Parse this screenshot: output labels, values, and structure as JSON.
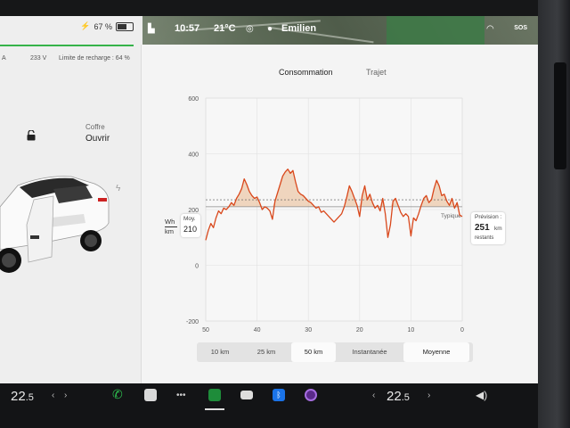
{
  "status": {
    "battery_percent": "67 %",
    "time": "10:57",
    "temperature": "21°C",
    "user": "Emilien",
    "sos": "SOS"
  },
  "charging": {
    "amps": "A",
    "voltage": "233 V",
    "limit": "Limite de recharge : 64 %"
  },
  "trunk": {
    "label": "Coffre",
    "action": "Ouvrir"
  },
  "tabs": [
    {
      "label": "Consommation",
      "active": true
    },
    {
      "label": "Trajet",
      "active": false
    }
  ],
  "chart_data": {
    "type": "line",
    "title": "Consommation",
    "xlabel": "",
    "ylabel": "Wh km",
    "ylabel_top": "Wh",
    "ylabel_bottom": "km",
    "xlim": [
      50,
      0
    ],
    "ylim": [
      -200,
      600
    ],
    "x_ticks": [
      "50",
      "40",
      "30",
      "20",
      "10",
      "0"
    ],
    "y_ticks": [
      "600",
      "400",
      "200",
      "0",
      "-200"
    ],
    "average_label": "Moy.",
    "average_value": "210",
    "typical_label": "Typique",
    "forecast_label": "Prévision :",
    "forecast_value": "251",
    "forecast_unit": "km",
    "forecast_suffix": "restants",
    "series": [
      {
        "color": "#d9481c",
        "x": [
          50,
          49.5,
          49,
          48.5,
          48,
          47.5,
          47,
          46.5,
          46,
          45.5,
          45,
          44.5,
          44,
          43.5,
          43,
          42.5,
          42,
          41.5,
          41,
          40.5,
          40,
          39.5,
          39,
          38.5,
          38,
          37.5,
          37,
          36.5,
          36,
          35.5,
          35,
          34.5,
          34,
          33.5,
          33,
          32.5,
          32,
          31.5,
          31,
          30.5,
          30,
          29.5,
          29,
          28.5,
          28,
          27.5,
          27,
          26.5,
          26,
          25.5,
          25,
          24.5,
          24,
          23.5,
          23,
          22.5,
          22,
          21.5,
          21,
          20.5,
          20,
          19.5,
          19,
          18.5,
          18,
          17.5,
          17,
          16.5,
          16,
          15.5,
          15,
          14.5,
          14,
          13.5,
          13,
          12.5,
          12,
          11.5,
          11,
          10.5,
          10,
          9.5,
          9,
          8.5,
          8,
          7.5,
          7,
          6.5,
          6,
          5.5,
          5,
          4.5,
          4,
          3.5,
          3,
          2.5,
          2,
          1.5,
          1,
          0.5,
          0
        ],
        "y": [
          90,
          125,
          150,
          135,
          170,
          195,
          185,
          205,
          200,
          210,
          225,
          215,
          240,
          255,
          275,
          310,
          290,
          265,
          250,
          240,
          245,
          225,
          200,
          210,
          205,
          195,
          165,
          230,
          260,
          290,
          320,
          335,
          345,
          330,
          340,
          300,
          265,
          255,
          250,
          240,
          230,
          225,
          215,
          205,
          210,
          190,
          195,
          185,
          175,
          165,
          155,
          165,
          175,
          185,
          210,
          245,
          285,
          265,
          240,
          215,
          175,
          250,
          285,
          235,
          255,
          225,
          205,
          215,
          195,
          240,
          185,
          100,
          145,
          230,
          240,
          215,
          190,
          175,
          185,
          175,
          105,
          170,
          160,
          185,
          215,
          240,
          250,
          225,
          235,
          275,
          305,
          285,
          250,
          255,
          230,
          215,
          240,
          205,
          225,
          180,
          175
        ]
      }
    ]
  },
  "range_buttons": [
    {
      "label": "10 km",
      "selected": false
    },
    {
      "label": "25 km",
      "selected": false
    },
    {
      "label": "50 km",
      "selected": true
    },
    {
      "label": "Instantanée",
      "selected": false
    },
    {
      "label": "Moyenne",
      "selected": true
    }
  ],
  "dock": {
    "temp_left": "22",
    "temp_left_decimal": ".5",
    "temp_right": "22",
    "temp_right_decimal": ".5"
  },
  "colors": {
    "accent": "#d9481c",
    "charge_green": "#35b34a"
  }
}
